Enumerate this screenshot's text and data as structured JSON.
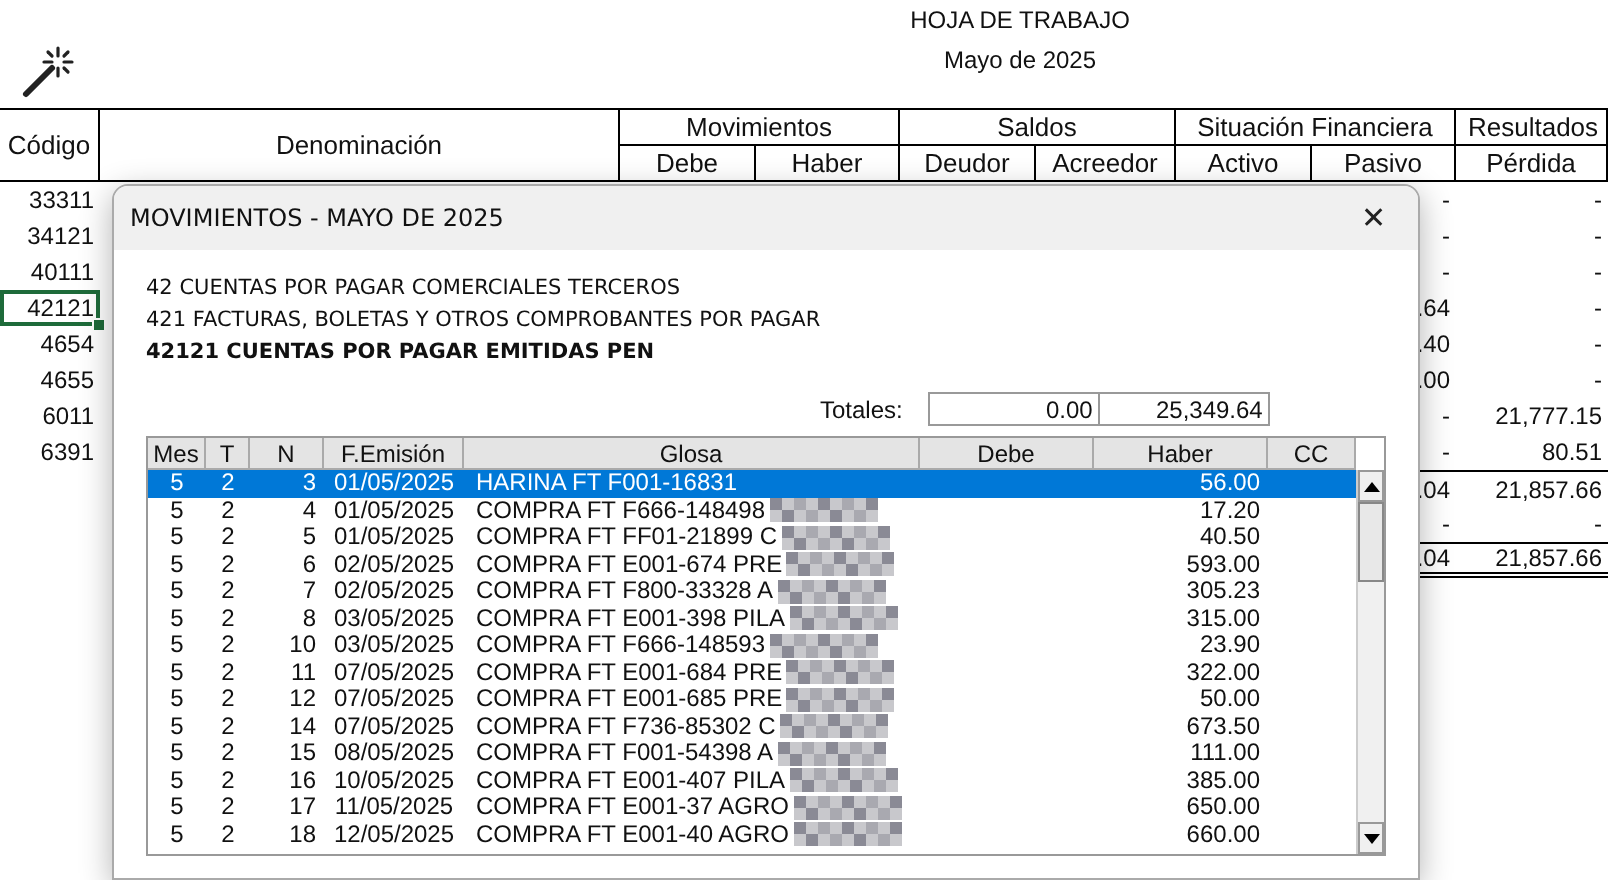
{
  "report": {
    "title": "HOJA DE TRABAJO",
    "subtitle": "Mayo de 2025"
  },
  "sheet": {
    "columns": [
      {
        "label": "Código"
      },
      {
        "label": "Denominación"
      }
    ],
    "groups": [
      {
        "label": "Movimientos",
        "subs": [
          "Debe",
          "Haber"
        ]
      },
      {
        "label": "Saldos",
        "subs": [
          "Deudor",
          "Acreedor"
        ]
      },
      {
        "label": "Situación Financiera",
        "subs": [
          "Activo",
          "Pasivo"
        ]
      },
      {
        "label": "Resultados",
        "subs": [
          "Pérdida"
        ]
      }
    ],
    "rows": [
      {
        "kind": "account",
        "code": "33311",
        "pasivo": "-",
        "perdida": "-",
        "selected": false
      },
      {
        "kind": "account",
        "code": "34121",
        "pasivo": "-",
        "perdida": "-",
        "selected": false
      },
      {
        "kind": "account",
        "code": "40111",
        "pasivo": "-",
        "perdida": "-",
        "selected": false
      },
      {
        "kind": "account",
        "code": "42121",
        "pasivo": ".64",
        "perdida": "-",
        "selected": true
      },
      {
        "kind": "account",
        "code": "4654",
        "pasivo": ".40",
        "perdida": "-",
        "selected": false
      },
      {
        "kind": "account",
        "code": "4655",
        "pasivo": ".00",
        "perdida": "-",
        "selected": false
      },
      {
        "kind": "account",
        "code": "6011",
        "pasivo": "-",
        "perdida": "21,777.15",
        "selected": false
      },
      {
        "kind": "account",
        "code": "6391",
        "pasivo": "-",
        "perdida": "80.51",
        "selected": false
      },
      {
        "kind": "total",
        "pasivo": ".04",
        "perdida": "21,857.66"
      },
      {
        "kind": "plain",
        "pasivo": "-",
        "perdida": "-"
      },
      {
        "kind": "grand",
        "pasivo": ".04",
        "perdida": "21,857.66"
      }
    ]
  },
  "dialog": {
    "title": "MOVIMIENTOS - MAYO DE 2025",
    "close": "✕",
    "lines": [
      {
        "text": "42 CUENTAS POR PAGAR COMERCIALES TERCEROS",
        "bold": false
      },
      {
        "text": "421 FACTURAS, BOLETAS Y OTROS COMPROBANTES POR PAGAR",
        "bold": false
      },
      {
        "text": "42121 CUENTAS POR PAGAR EMITIDAS PEN",
        "bold": true
      }
    ],
    "totals": {
      "label": "Totales:",
      "debe": "0.00",
      "haber": "25,349.64"
    },
    "columns": [
      "Mes",
      "T",
      "N",
      "F.Emisión",
      "Glosa",
      "Debe",
      "Haber",
      "CC"
    ],
    "rows": [
      {
        "mes": "5",
        "t": "2",
        "n": "3",
        "fecha": "01/05/2025",
        "glosa": "HARINA FT F001-16831",
        "redacted": false,
        "debe": "",
        "haber": "56.00",
        "selected": true
      },
      {
        "mes": "5",
        "t": "2",
        "n": "4",
        "fecha": "01/05/2025",
        "glosa": "COMPRA FT F666-148498",
        "redacted": true,
        "debe": "",
        "haber": "17.20",
        "selected": false
      },
      {
        "mes": "5",
        "t": "2",
        "n": "5",
        "fecha": "01/05/2025",
        "glosa": "COMPRA FT FF01-21899 C",
        "redacted": true,
        "debe": "",
        "haber": "40.50",
        "selected": false
      },
      {
        "mes": "5",
        "t": "2",
        "n": "6",
        "fecha": "02/05/2025",
        "glosa": "COMPRA FT E001-674 PRE",
        "redacted": true,
        "debe": "",
        "haber": "593.00",
        "selected": false
      },
      {
        "mes": "5",
        "t": "2",
        "n": "7",
        "fecha": "02/05/2025",
        "glosa": "COMPRA FT F800-33328 A",
        "redacted": true,
        "debe": "",
        "haber": "305.23",
        "selected": false
      },
      {
        "mes": "5",
        "t": "2",
        "n": "8",
        "fecha": "03/05/2025",
        "glosa": "COMPRA FT E001-398 PILA",
        "redacted": true,
        "debe": "",
        "haber": "315.00",
        "selected": false
      },
      {
        "mes": "5",
        "t": "2",
        "n": "10",
        "fecha": "03/05/2025",
        "glosa": "COMPRA FT F666-148593",
        "redacted": true,
        "debe": "",
        "haber": "23.90",
        "selected": false
      },
      {
        "mes": "5",
        "t": "2",
        "n": "11",
        "fecha": "07/05/2025",
        "glosa": "COMPRA FT E001-684 PRE",
        "redacted": true,
        "debe": "",
        "haber": "322.00",
        "selected": false
      },
      {
        "mes": "5",
        "t": "2",
        "n": "12",
        "fecha": "07/05/2025",
        "glosa": "COMPRA FT E001-685 PRE",
        "redacted": true,
        "debe": "",
        "haber": "50.00",
        "selected": false
      },
      {
        "mes": "5",
        "t": "2",
        "n": "14",
        "fecha": "07/05/2025",
        "glosa": "COMPRA FT F736-85302 C",
        "redacted": true,
        "debe": "",
        "haber": "673.50",
        "selected": false
      },
      {
        "mes": "5",
        "t": "2",
        "n": "15",
        "fecha": "08/05/2025",
        "glosa": "COMPRA FT F001-54398 A",
        "redacted": true,
        "debe": "",
        "haber": "111.00",
        "selected": false
      },
      {
        "mes": "5",
        "t": "2",
        "n": "16",
        "fecha": "10/05/2025",
        "glosa": "COMPRA FT E001-407 PILA",
        "redacted": true,
        "debe": "",
        "haber": "385.00",
        "selected": false
      },
      {
        "mes": "5",
        "t": "2",
        "n": "17",
        "fecha": "11/05/2025",
        "glosa": "COMPRA FT E001-37 AGRO",
        "redacted": true,
        "debe": "",
        "haber": "650.00",
        "selected": false
      },
      {
        "mes": "5",
        "t": "2",
        "n": "18",
        "fecha": "12/05/2025",
        "glosa": "COMPRA FT E001-40 AGRO",
        "redacted": true,
        "debe": "",
        "haber": "660.00",
        "selected": false
      }
    ]
  }
}
